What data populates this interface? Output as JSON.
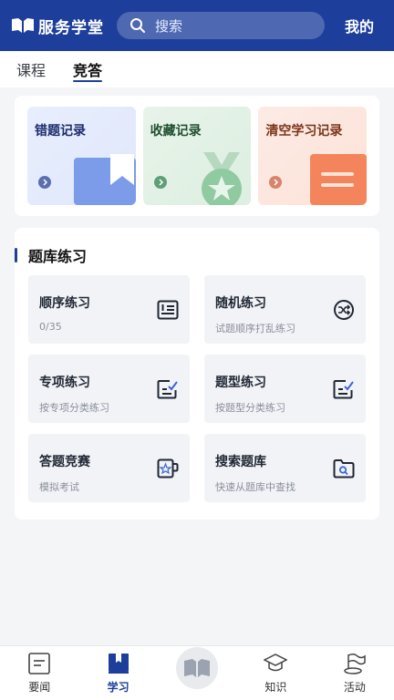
{
  "header": {
    "app_name": "服务学堂",
    "search_placeholder": "搜索",
    "mine_label": "我的"
  },
  "tabs": [
    {
      "label": "课程",
      "active": false
    },
    {
      "label": "竞答",
      "active": true
    }
  ],
  "records": [
    {
      "title": "错题记录",
      "icon": "bookmark-icon"
    },
    {
      "title": "收藏记录",
      "icon": "medal-star-icon"
    },
    {
      "title": "清空学习记录",
      "icon": "document-lines-icon"
    }
  ],
  "practice": {
    "section_title": "题库练习",
    "items": [
      {
        "title": "顺序练习",
        "subtitle": "0/35",
        "icon": "list-order-icon"
      },
      {
        "title": "随机练习",
        "subtitle": "试题顺序打乱练习",
        "icon": "shuffle-icon"
      },
      {
        "title": "专项练习",
        "subtitle": "按专项分类练习",
        "icon": "edit-check-icon"
      },
      {
        "title": "题型练习",
        "subtitle": "按题型分类练习",
        "icon": "edit-check-icon"
      },
      {
        "title": "答题竞赛",
        "subtitle": "模拟考试",
        "icon": "cup-star-icon"
      },
      {
        "title": "搜索题库",
        "subtitle": "快速从题库中查找",
        "icon": "folder-search-icon"
      }
    ]
  },
  "bottom_nav": [
    {
      "label": "要闻",
      "icon": "news-icon",
      "active": false
    },
    {
      "label": "学习",
      "icon": "book-icon",
      "active": true
    },
    {
      "label": "",
      "icon": "open-book-icon",
      "active": false
    },
    {
      "label": "知识",
      "icon": "graduation-cap-icon",
      "active": false
    },
    {
      "label": "活动",
      "icon": "flag-icon",
      "active": false
    }
  ],
  "colors": {
    "brand": "#1d3f9b",
    "background": "#f4f5f7"
  }
}
